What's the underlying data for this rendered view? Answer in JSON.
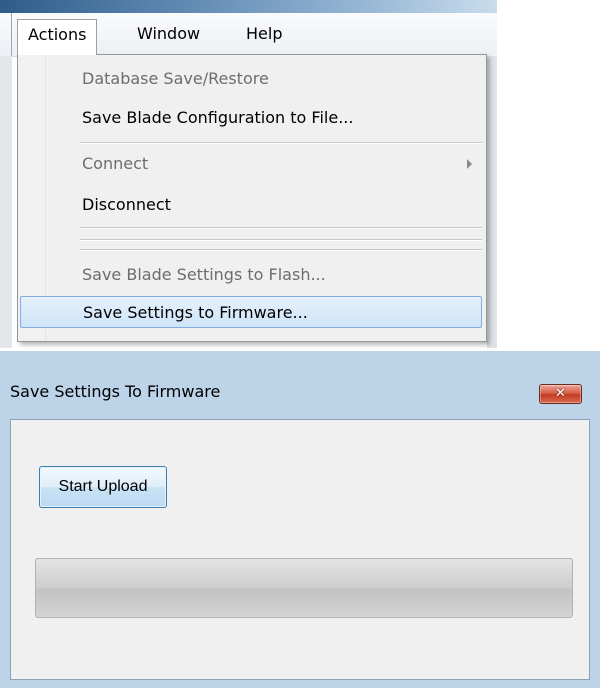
{
  "menubar": {
    "items": [
      "Actions",
      "Window",
      "Help"
    ],
    "open_menu": "Actions"
  },
  "dropdown": {
    "items": [
      {
        "label": "Database Save/Restore",
        "enabled": false
      },
      {
        "label": "Save Blade Configuration to File...",
        "enabled": true
      },
      {
        "label": "Connect",
        "enabled": false,
        "submenu": true
      },
      {
        "label": "Disconnect",
        "enabled": true
      },
      {
        "label": "Save Blade Settings to Flash...",
        "enabled": false
      },
      {
        "label": "Save Settings to Firmware...",
        "enabled": true,
        "highlighted": true
      }
    ],
    "submenu_icon": "chevron-right-icon"
  },
  "dialog": {
    "title": "Save Settings To Firmware",
    "close_icon": "close-icon",
    "start_button_label": "Start Upload",
    "progress_fraction": 0
  },
  "colors": {
    "highlight_bg": "#cfe4fa",
    "highlight_border": "#84acdd",
    "close_button": "#c94a33",
    "button_border": "#3c7fb1",
    "dialog_frame": "#bdd3e8"
  }
}
